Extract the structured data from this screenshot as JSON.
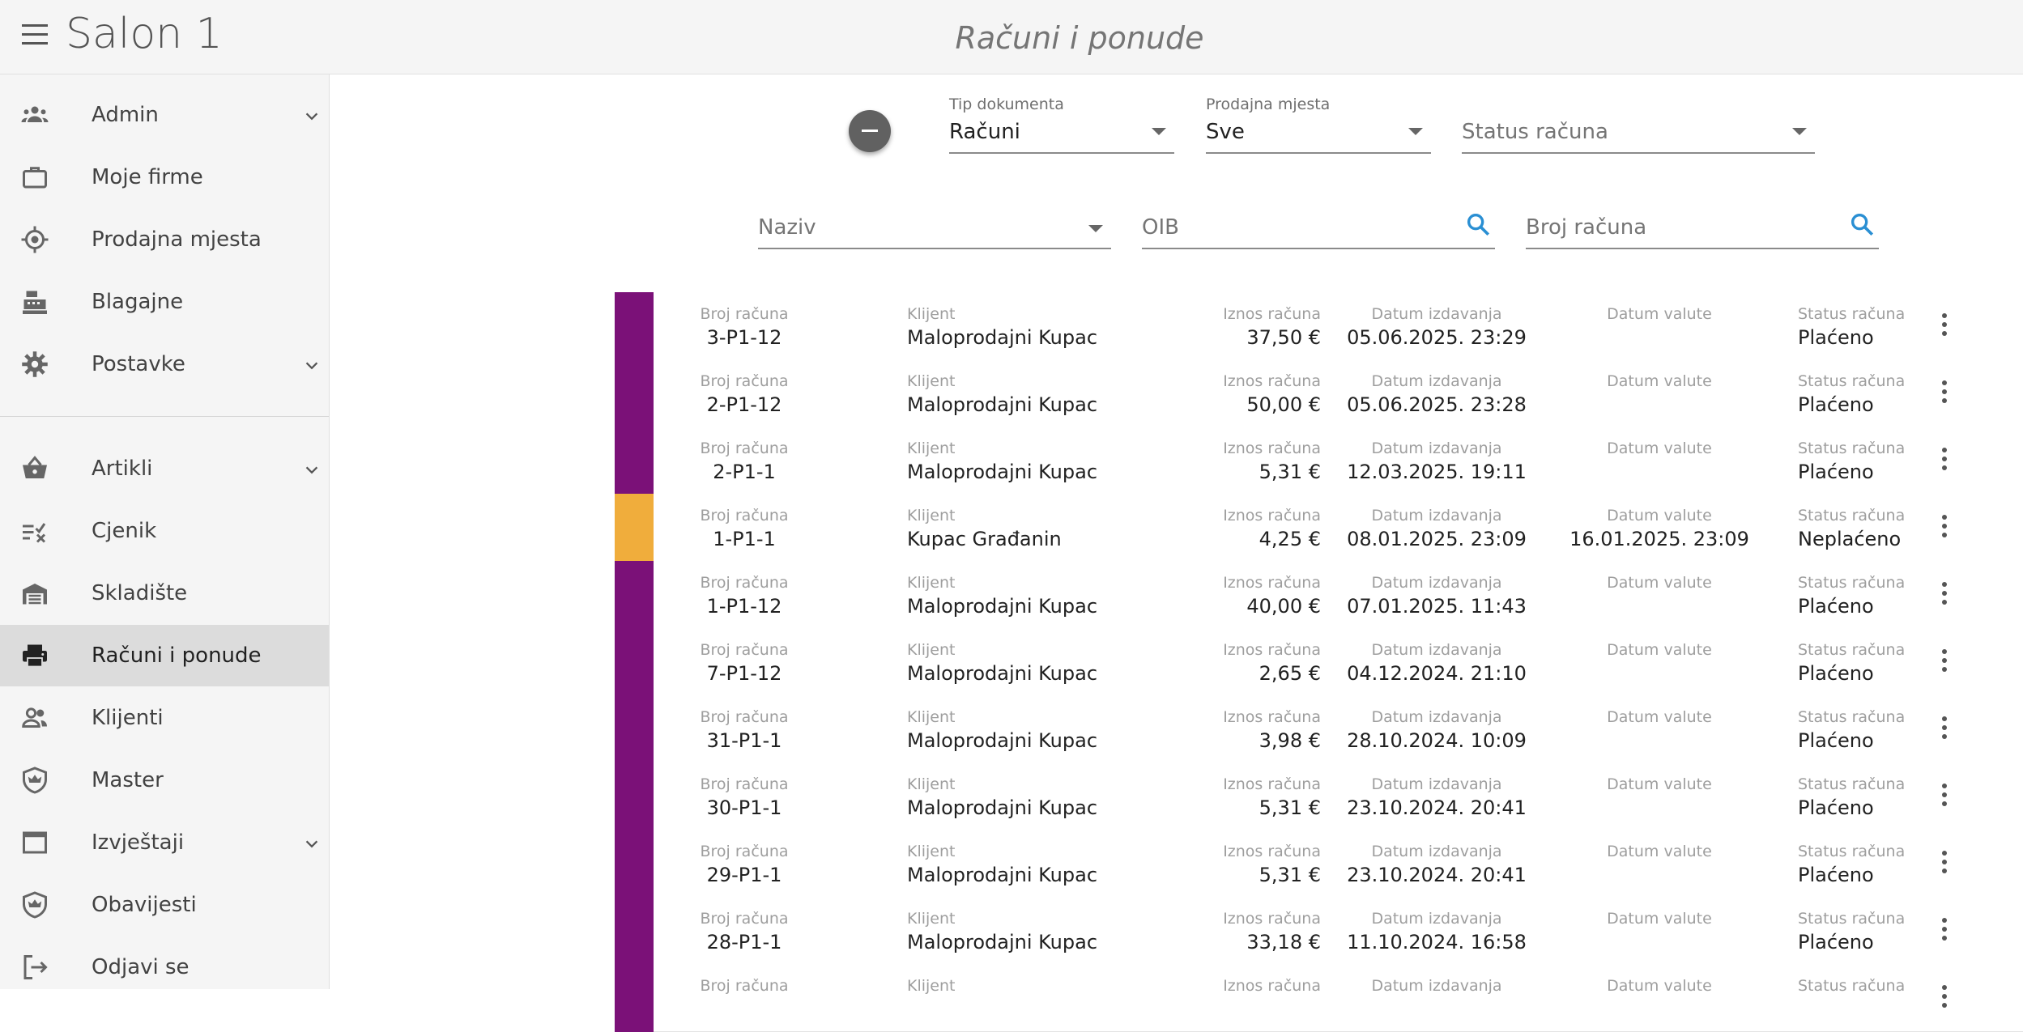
{
  "app": {
    "title": "Salon 1",
    "page_title": "Računi i ponude"
  },
  "sidebar": {
    "items": [
      {
        "label": "Admin",
        "icon": "people-icon",
        "expandable": true
      },
      {
        "label": "Moje firme",
        "icon": "briefcase-icon",
        "expandable": false
      },
      {
        "label": "Prodajna mjesta",
        "icon": "location-target-icon",
        "expandable": false
      },
      {
        "label": "Blagajne",
        "icon": "cash-register-icon",
        "expandable": false
      },
      {
        "label": "Postavke",
        "icon": "gear-icon",
        "expandable": true
      },
      {
        "label": "Artikli",
        "icon": "basket-icon",
        "expandable": true
      },
      {
        "label": "Cjenik",
        "icon": "price-list-icon",
        "expandable": false
      },
      {
        "label": "Skladište",
        "icon": "warehouse-icon",
        "expandable": false
      },
      {
        "label": "Računi i ponude",
        "icon": "printer-icon",
        "expandable": false,
        "active": true
      },
      {
        "label": "Klijenti",
        "icon": "clients-icon",
        "expandable": false
      },
      {
        "label": "Master",
        "icon": "shield-crown-icon",
        "expandable": false
      },
      {
        "label": "Izvještaji",
        "icon": "window-icon",
        "expandable": true
      },
      {
        "label": "Obavijesti",
        "icon": "shield-crown-icon",
        "expandable": false
      },
      {
        "label": "Odjavi se",
        "icon": "logout-icon",
        "expandable": false
      }
    ]
  },
  "filters": {
    "tip_dokumenta": {
      "label": "Tip dokumenta",
      "value": "Računi"
    },
    "prodajna_mjesta": {
      "label": "Prodajna mjesta",
      "value": "Sve"
    },
    "status": {
      "placeholder": "Status računa"
    },
    "naziv": {
      "placeholder": "Naziv"
    },
    "oib": {
      "placeholder": "OIB"
    },
    "broj": {
      "placeholder": "Broj računa"
    }
  },
  "table": {
    "labels": {
      "broj": "Broj računa",
      "klijent": "Klijent",
      "iznos": "Iznos računa",
      "datum_izdavanja": "Datum izdavanja",
      "datum_valute": "Datum valute",
      "status": "Status računa"
    },
    "colors": {
      "paid": "#7b1178",
      "unpaid": "#f0ad3c"
    },
    "rows": [
      {
        "broj": "3-P1-12",
        "klijent": "Maloprodajni Kupac",
        "iznos": "37,50 €",
        "datum_izdavanja": "05.06.2025. 23:29",
        "datum_valute": "",
        "status": "Plaćeno",
        "paid": true
      },
      {
        "broj": "2-P1-12",
        "klijent": "Maloprodajni Kupac",
        "iznos": "50,00 €",
        "datum_izdavanja": "05.06.2025. 23:28",
        "datum_valute": "",
        "status": "Plaćeno",
        "paid": true
      },
      {
        "broj": "2-P1-1",
        "klijent": "Maloprodajni Kupac",
        "iznos": "5,31 €",
        "datum_izdavanja": "12.03.2025. 19:11",
        "datum_valute": "",
        "status": "Plaćeno",
        "paid": true
      },
      {
        "broj": "1-P1-1",
        "klijent": "Kupac Građanin",
        "iznos": "4,25 €",
        "datum_izdavanja": "08.01.2025. 23:09",
        "datum_valute": "16.01.2025. 23:09",
        "status": "Neplaćeno",
        "paid": false
      },
      {
        "broj": "1-P1-12",
        "klijent": "Maloprodajni Kupac",
        "iznos": "40,00 €",
        "datum_izdavanja": "07.01.2025. 11:43",
        "datum_valute": "",
        "status": "Plaćeno",
        "paid": true
      },
      {
        "broj": "7-P1-12",
        "klijent": "Maloprodajni Kupac",
        "iznos": "2,65 €",
        "datum_izdavanja": "04.12.2024. 21:10",
        "datum_valute": "",
        "status": "Plaćeno",
        "paid": true
      },
      {
        "broj": "31-P1-1",
        "klijent": "Maloprodajni Kupac",
        "iznos": "3,98 €",
        "datum_izdavanja": "28.10.2024. 10:09",
        "datum_valute": "",
        "status": "Plaćeno",
        "paid": true
      },
      {
        "broj": "30-P1-1",
        "klijent": "Maloprodajni Kupac",
        "iznos": "5,31 €",
        "datum_izdavanja": "23.10.2024. 20:41",
        "datum_valute": "",
        "status": "Plaćeno",
        "paid": true
      },
      {
        "broj": "29-P1-1",
        "klijent": "Maloprodajni Kupac",
        "iznos": "5,31 €",
        "datum_izdavanja": "23.10.2024. 20:41",
        "datum_valute": "",
        "status": "Plaćeno",
        "paid": true
      },
      {
        "broj": "28-P1-1",
        "klijent": "Maloprodajni Kupac",
        "iznos": "33,18 €",
        "datum_izdavanja": "11.10.2024. 16:58",
        "datum_valute": "",
        "status": "Plaćeno",
        "paid": true
      },
      {
        "broj": "",
        "klijent": "",
        "iznos": "",
        "datum_izdavanja": "",
        "datum_valute": "",
        "status": "",
        "paid": true
      }
    ]
  }
}
